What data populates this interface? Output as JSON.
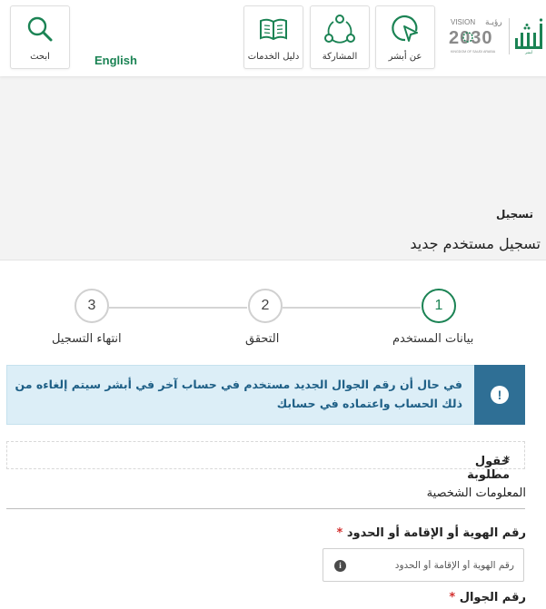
{
  "header": {
    "search_label": "ابحث",
    "language_label": "English",
    "services_guide_label": "دليل الخدمات",
    "participation_label": "المشاركة",
    "about_label": "عن أبشر",
    "vision_text": "VISION",
    "vision_year": "2030",
    "vision_arabic": "رؤيـة",
    "vision_kingdom": "KINGDOM OF SAUDI ARABIA",
    "logo_text": "أبشر",
    "brand_color": "#1b8354"
  },
  "breadcrumb": "تسجيل",
  "page_title": "تسجيل مستخدم جديد",
  "stepper": {
    "steps": [
      {
        "number": "1",
        "label": "بيانات المستخدم",
        "active": true
      },
      {
        "number": "2",
        "label": "التحقق",
        "active": false
      },
      {
        "number": "3",
        "label": "انتهاء التسجيل",
        "active": false
      }
    ]
  },
  "alert": {
    "icon": "exclamation-icon",
    "text": "في حال أن رقم الجوال الجديد مستخدم في حساب آخر في أبشر سيتم إلغاءه من ذلك الحساب واعتماده في حسابك"
  },
  "required_note": "حقول مطلوبة",
  "required_marker": "*",
  "section": {
    "title": "المعلومات الشخصية"
  },
  "form": {
    "id_label": "رقم الهوية أو الإقامة أو الحدود",
    "id_placeholder": "رقم الهوية أو الإقامة أو الحدود",
    "mobile_label": "رقم الجوال"
  }
}
